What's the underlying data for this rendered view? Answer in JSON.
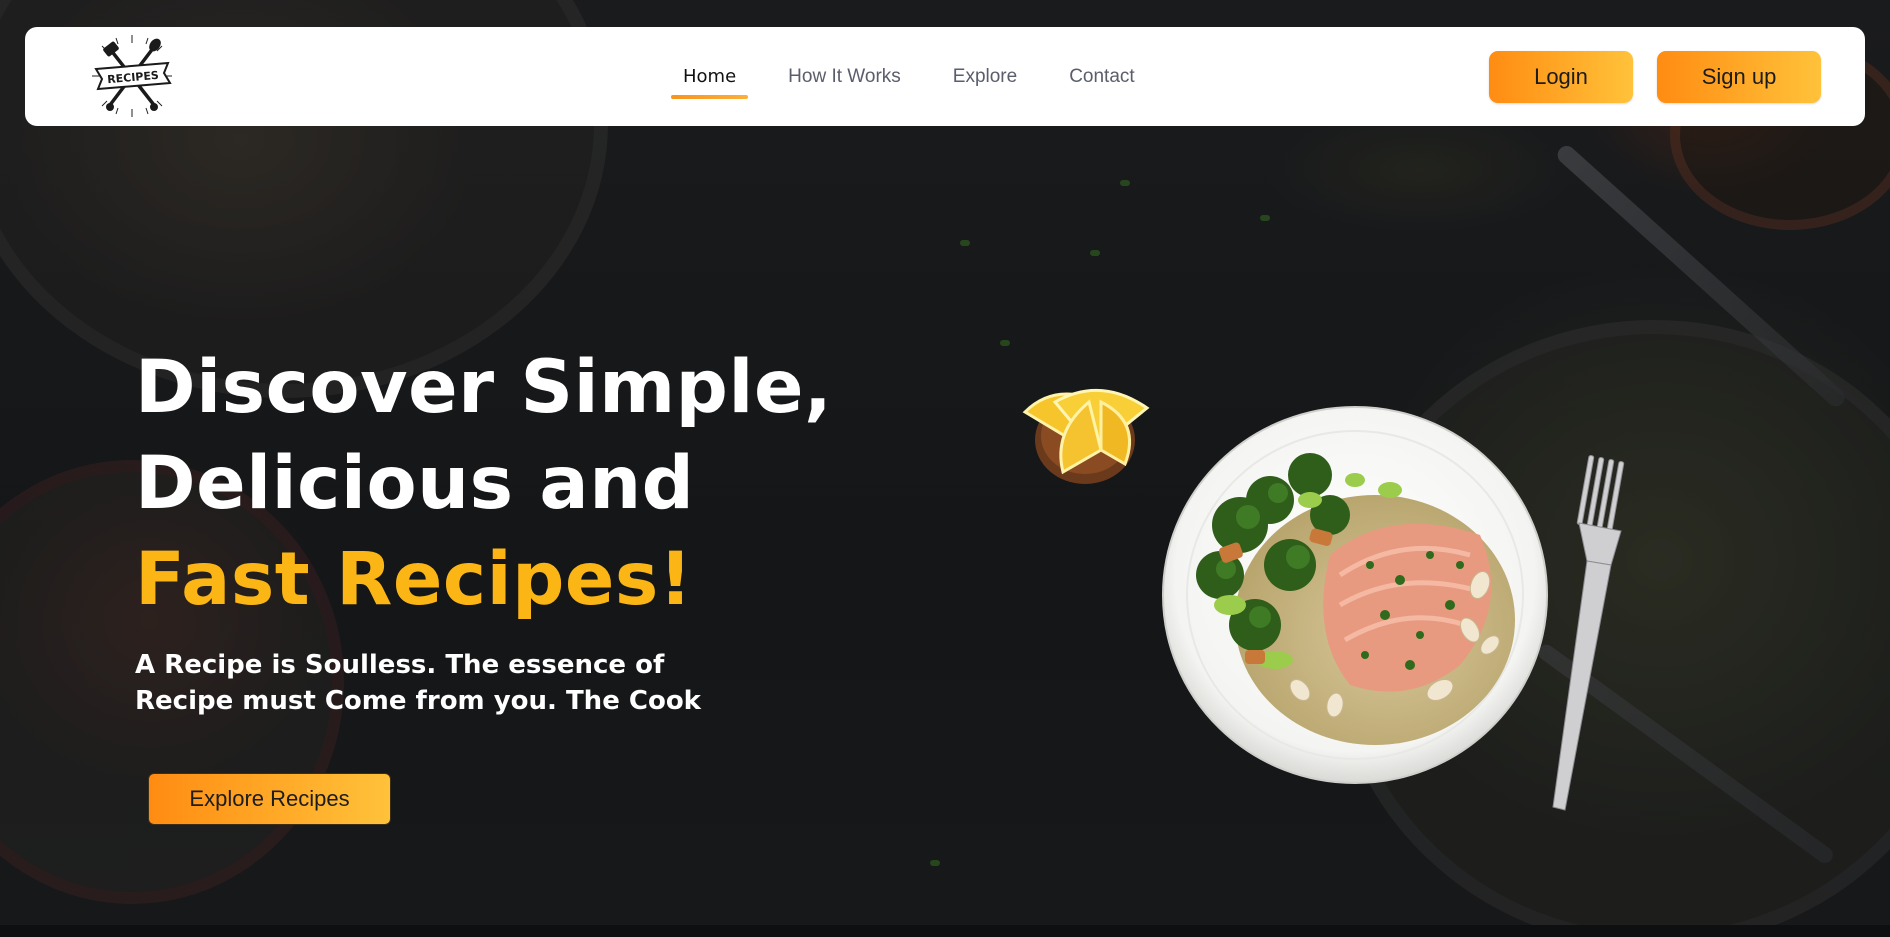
{
  "logo": {
    "text": "RECIPES",
    "icon": "recipes-logo-crossed-utensils"
  },
  "nav": {
    "items": [
      {
        "label": "Home",
        "active": true
      },
      {
        "label": "How It Works",
        "active": false
      },
      {
        "label": "Explore",
        "active": false
      },
      {
        "label": "Contact",
        "active": false
      }
    ],
    "login_label": "Login",
    "signup_label": "Sign up"
  },
  "hero": {
    "title_line1": "Discover Simple,",
    "title_line2": "Delicious and",
    "title_accent": "Fast Recipes!",
    "tagline": "A Recipe is Soulless. The essence of Recipe must Come from you. The Cook",
    "cta_label": "Explore Recipes"
  },
  "colors": {
    "accent_gradient_start": "#ff8c12",
    "accent_gradient_end": "#ffc23a",
    "title_accent": "#fbb616",
    "background": "#15171a"
  },
  "images": {
    "main_dish": "salmon-quinoa-broccoli-plate",
    "side": "lemon-wedges-bowl",
    "utensil": "fork"
  }
}
